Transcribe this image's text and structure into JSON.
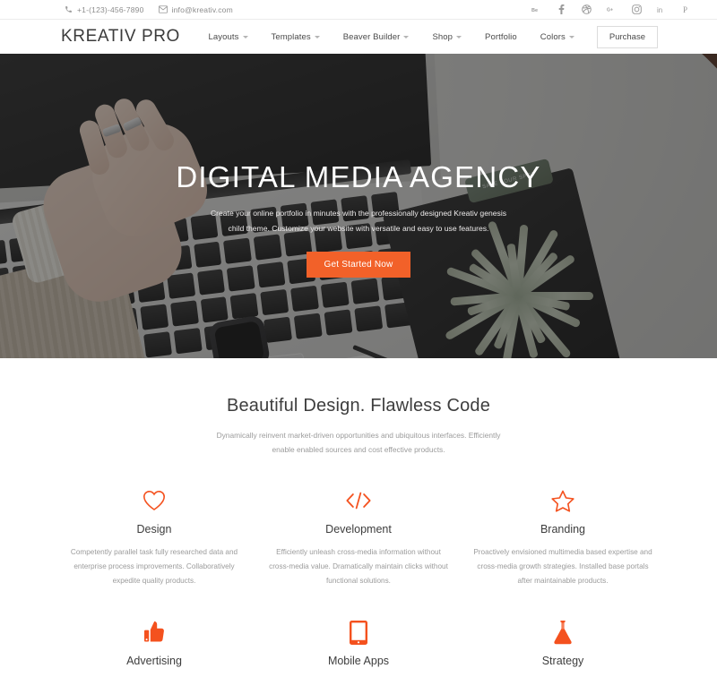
{
  "topbar": {
    "phone": "+1-(123)-456-7890",
    "email": "info@kreativ.com",
    "socials": [
      {
        "name": "behance-icon",
        "label": "Be"
      },
      {
        "name": "facebook-icon",
        "label": "f"
      },
      {
        "name": "dribbble-icon",
        "label": "dribbble"
      },
      {
        "name": "google-plus-icon",
        "label": "G+"
      },
      {
        "name": "instagram-icon",
        "label": "instagram"
      },
      {
        "name": "linkedin-icon",
        "label": "in"
      },
      {
        "name": "pinterest-icon",
        "label": "P"
      }
    ]
  },
  "header": {
    "logo": "KREATIV PRO",
    "nav": [
      {
        "label": "Layouts",
        "has_dropdown": true
      },
      {
        "label": "Templates",
        "has_dropdown": true
      },
      {
        "label": "Beaver Builder",
        "has_dropdown": true
      },
      {
        "label": "Shop",
        "has_dropdown": true
      },
      {
        "label": "Portfolio",
        "has_dropdown": false
      },
      {
        "label": "Colors",
        "has_dropdown": true
      }
    ],
    "purchase": "Purchase"
  },
  "hero": {
    "title": "DIGITAL MEDIA AGENCY",
    "subtitle": "Create your online portfolio in minutes with the professionally designed Kreativ genesis child theme. Customize your website with versatile and easy to use features.",
    "cta": "Get Started Now",
    "cta_color": "#f26129",
    "notebook_tag": "SAVE YOUR SPOT"
  },
  "features": {
    "title": "Beautiful Design. Flawless Code",
    "subtitle": "Dynamically reinvent market-driven opportunities and ubiquitous interfaces. Efficiently enable enabled sources and cost effective products.",
    "accent_color": "#f4511e",
    "items": [
      {
        "icon": "heart-icon",
        "title": "Design",
        "desc": "Competently parallel task fully researched data and enterprise process improvements. Collaboratively expedite quality products."
      },
      {
        "icon": "code-icon",
        "title": "Development",
        "desc": "Efficiently unleash cross-media information without cross-media value. Dramatically maintain clicks without functional solutions."
      },
      {
        "icon": "star-icon",
        "title": "Branding",
        "desc": "Proactively envisioned multimedia based expertise and cross-media growth strategies. Installed base portals after maintainable products."
      },
      {
        "icon": "thumbs-up-icon",
        "title": "Advertising",
        "desc": ""
      },
      {
        "icon": "tablet-icon",
        "title": "Mobile Apps",
        "desc": ""
      },
      {
        "icon": "flask-icon",
        "title": "Strategy",
        "desc": ""
      }
    ]
  }
}
